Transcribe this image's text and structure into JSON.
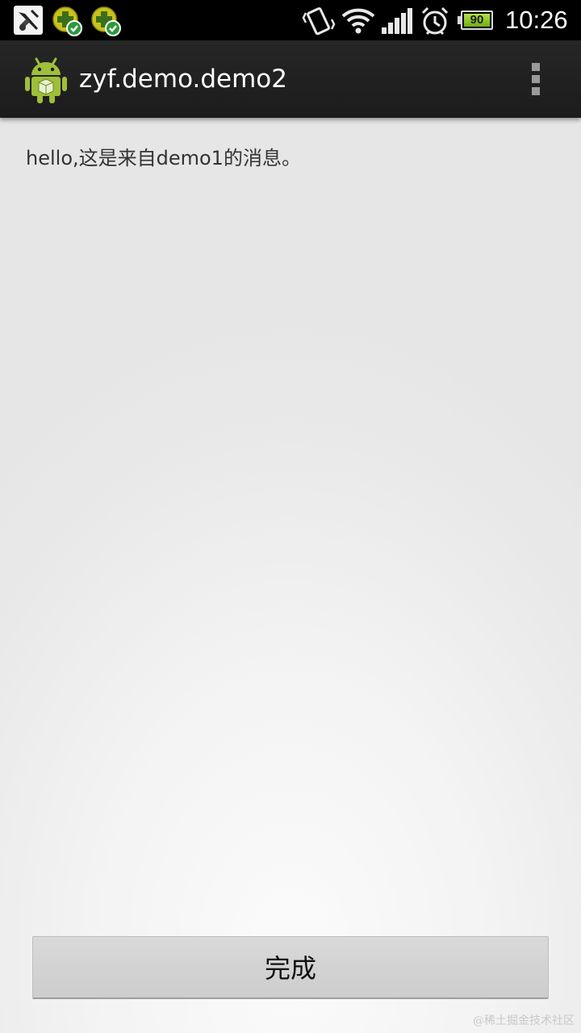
{
  "status_bar": {
    "notification_icons": [
      "app-notification-icon",
      "plugin-update-icon",
      "plugin-update-icon"
    ],
    "system_icons": [
      "vibrate-icon",
      "wifi-icon",
      "signal-icon",
      "alarm-icon",
      "battery-icon"
    ],
    "battery_level": "90",
    "time": "10:26"
  },
  "action_bar": {
    "title": "zyf.demo.demo2",
    "logo_icon": "android-robot-icon",
    "overflow_icon": "overflow-menu-icon"
  },
  "content": {
    "message": "hello,这是来自demo1的消息。"
  },
  "done_button": {
    "label": "完成"
  },
  "watermark": "@稀土掘金技术社区",
  "colors": {
    "status_bar_bg": "#000000",
    "action_bar_bg": "#222222",
    "battery_fill": "#8cc63f",
    "android_green": "#9fbf3b"
  }
}
